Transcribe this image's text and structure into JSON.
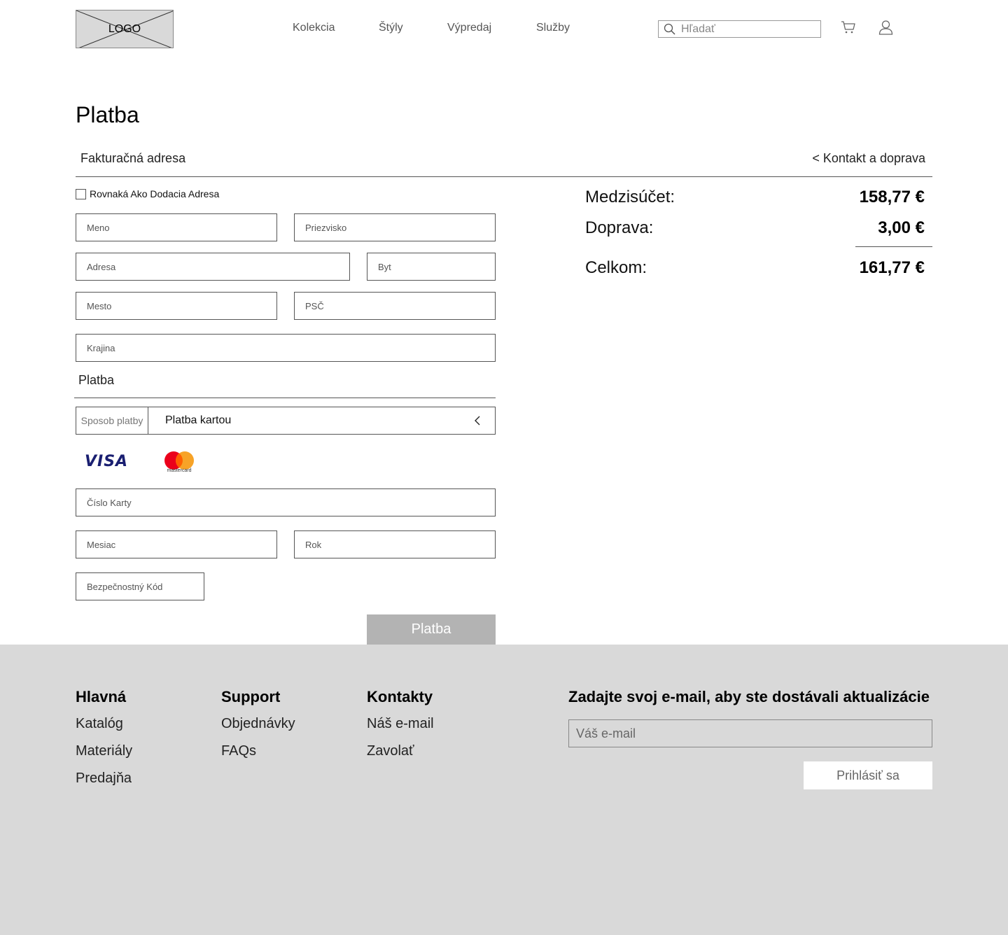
{
  "header": {
    "logo_text": "LOGO",
    "nav": [
      "Kolekcia",
      "Štýly",
      "Výpredaj",
      "Služby"
    ],
    "search_placeholder": "Hľadať"
  },
  "page": {
    "title": "Platba",
    "billing_heading": "Fakturačná adresa",
    "back_link": "< Kontakt a doprava",
    "same_as_shipping_label": "Rovnaká Ako Dodacia Adresa",
    "same_as_shipping_checked": false
  },
  "billing_form": {
    "first_name": "Meno",
    "last_name": "Priezvisko",
    "address": "Adresa",
    "apartment": "Byt",
    "city": "Mesto",
    "zip": "PSČ",
    "country": "Krajina"
  },
  "payment": {
    "heading": "Platba",
    "method_label": "Sposob platby",
    "method_value": "Platba kartou",
    "visa_text": "VISA",
    "mastercard_text": "mastercard",
    "card_number": "Číslo Karty",
    "month": "Mesiac",
    "year": "Rok",
    "cvc": "Bezpečnostný Kód",
    "submit_label": "Platba"
  },
  "summary": {
    "subtotal_label": "Medzisúčet:",
    "subtotal_value": "158,77 €",
    "shipping_label": "Doprava:",
    "shipping_value": "3,00 €",
    "total_label": "Celkom:",
    "total_value": "161,77 €"
  },
  "footer": {
    "columns": [
      {
        "title": "Hlavná",
        "links": [
          "Katalóg",
          "Materiály",
          "Predajňa"
        ]
      },
      {
        "title": "Support",
        "links": [
          "Objednávky",
          "FAQs"
        ]
      },
      {
        "title": "Kontakty",
        "links": [
          "Náš e-mail",
          "Zavolať"
        ]
      }
    ],
    "newsletter_title": "Zadajte svoj e-mail, aby ste dostávali aktualizácie",
    "newsletter_placeholder": "Váš e-mail",
    "newsletter_button": "Prihlásiť sa"
  },
  "colors": {
    "footer_bg": "#d9d9d9",
    "button_disabled": "#b3b3b3",
    "visa_blue": "#1a1f71",
    "mc_red": "#eb001b",
    "mc_orange": "#f79e1b"
  }
}
